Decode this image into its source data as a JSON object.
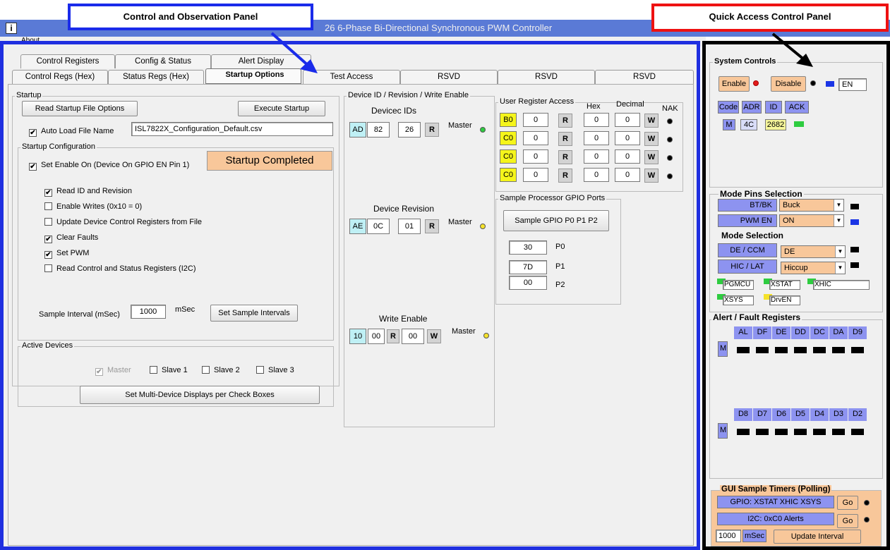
{
  "window": {
    "title": "26 6-Phase Bi-Directional Synchronous PWM Controller",
    "menu_about": "About"
  },
  "callouts": {
    "left": "Control and Observation Panel",
    "right": "Quick Access Control Panel"
  },
  "tabs_row1": [
    "Control Registers",
    "Config & Status",
    "Alert Display"
  ],
  "tabs_row2": [
    "Control Regs (Hex)",
    "Status Regs (Hex)",
    "Startup Options",
    "Test Access",
    "RSVD",
    "RSVD",
    "RSVD"
  ],
  "startup": {
    "group": "Startup",
    "read_btn": "Read Startup File Options",
    "exec_btn": "Execute Startup",
    "autoload": "Auto Load File Name",
    "filename": "ISL7822X_Configuration_Default.csv",
    "config_group": "Startup Configuration",
    "set_enable": "Set Enable On (Device On GPIO  EN Pin 1)",
    "status": "Startup Completed",
    "options": [
      {
        "label": "Read ID and Revision",
        "checked": "✔"
      },
      {
        "label": "Enable Writes (0x10 = 0)",
        "checked": ""
      },
      {
        "label": "Update Device Control Registers from File",
        "checked": ""
      },
      {
        "label": "Clear Faults",
        "checked": "✔"
      },
      {
        "label": "Set PWM",
        "checked": "✔"
      },
      {
        "label": "Read Control and Status Registers (I2C)",
        "checked": ""
      }
    ],
    "sample_label": "Sample Interval (mSec)",
    "sample_value": "1000",
    "sample_unit": "mSec",
    "sample_btn": "Set Sample Intervals"
  },
  "active": {
    "group": "Active Devices",
    "master": "Master",
    "slave1": "Slave 1",
    "slave2": "Slave 2",
    "slave3": "Slave 3",
    "btn": "Set Multi-Device Displays per Check Boxes"
  },
  "devid": {
    "group": "Device ID / Revision / Write Enable",
    "ids_label": "Devicec IDs",
    "id_addr": "AD",
    "id_v1": "82",
    "id_v2": "26",
    "rev_label": "Device Revision",
    "rev_addr": "AE",
    "rev_v1": "0C",
    "rev_v2": "01",
    "we_label": "Write Enable",
    "we_addr": "10",
    "we_v1": "00",
    "we_v2": "00",
    "master": "Master",
    "r": "R",
    "w": "W"
  },
  "ura": {
    "group": "User Register Access",
    "hex": "Hex",
    "decimal": "Decimal",
    "nak": "NAK",
    "rows": [
      {
        "addr": "B0",
        "val": "0",
        "hex": "0",
        "dec": "0"
      },
      {
        "addr": "C0",
        "val": "0",
        "hex": "0",
        "dec": "0"
      },
      {
        "addr": "C0",
        "val": "0",
        "hex": "0",
        "dec": "0"
      },
      {
        "addr": "C0",
        "val": "0",
        "hex": "0",
        "dec": "0"
      }
    ]
  },
  "gpio": {
    "group": "Sample Processor GPIO Ports",
    "btn": "Sample GPIO P0  P1 P2",
    "p0": "30",
    "p1": "7D",
    "p2": "00",
    "p0l": "P0",
    "p1l": "P1",
    "p2l": "P2"
  },
  "qp": {
    "sys": "System Controls",
    "enable": "Enable",
    "disable": "Disable",
    "en": "EN",
    "code": "Code",
    "adr": "ADR",
    "id": "ID",
    "ack": "ACK",
    "m": "M",
    "v4c": "4C",
    "v2682": "2682",
    "mode": "Mode Pins Selection",
    "btbk": "BT/BK",
    "buck": "Buck",
    "pwmen": "PWM EN",
    "on": "ON",
    "modesel": "Mode Selection",
    "decmm": "DE / CCM",
    "de": "DE",
    "hiclat": "HIC / LAT",
    "hiccup": "Hiccup",
    "pgmcu": "PGMCU",
    "xstat": "XSTAT",
    "xhic": "XHIC",
    "xsys": "XSYS",
    "drven": "DrvEN",
    "alert": "Alert /  Fault Registers",
    "row1": [
      "AL",
      "DF",
      "DE",
      "DD",
      "DC",
      "DA",
      "D9"
    ],
    "row2": [
      "D8",
      "D7",
      "D6",
      "D5",
      "D4",
      "D3",
      "D2"
    ],
    "timers": "GUI Sample Timers (Polling)",
    "gpio_t": "GPIO: XSTAT XHIC XSYS",
    "i2c_t": "I2C: 0xC0 Alerts",
    "go": "Go",
    "ms_val": "1000",
    "ms": "mSec",
    "update": "Update Interval"
  }
}
